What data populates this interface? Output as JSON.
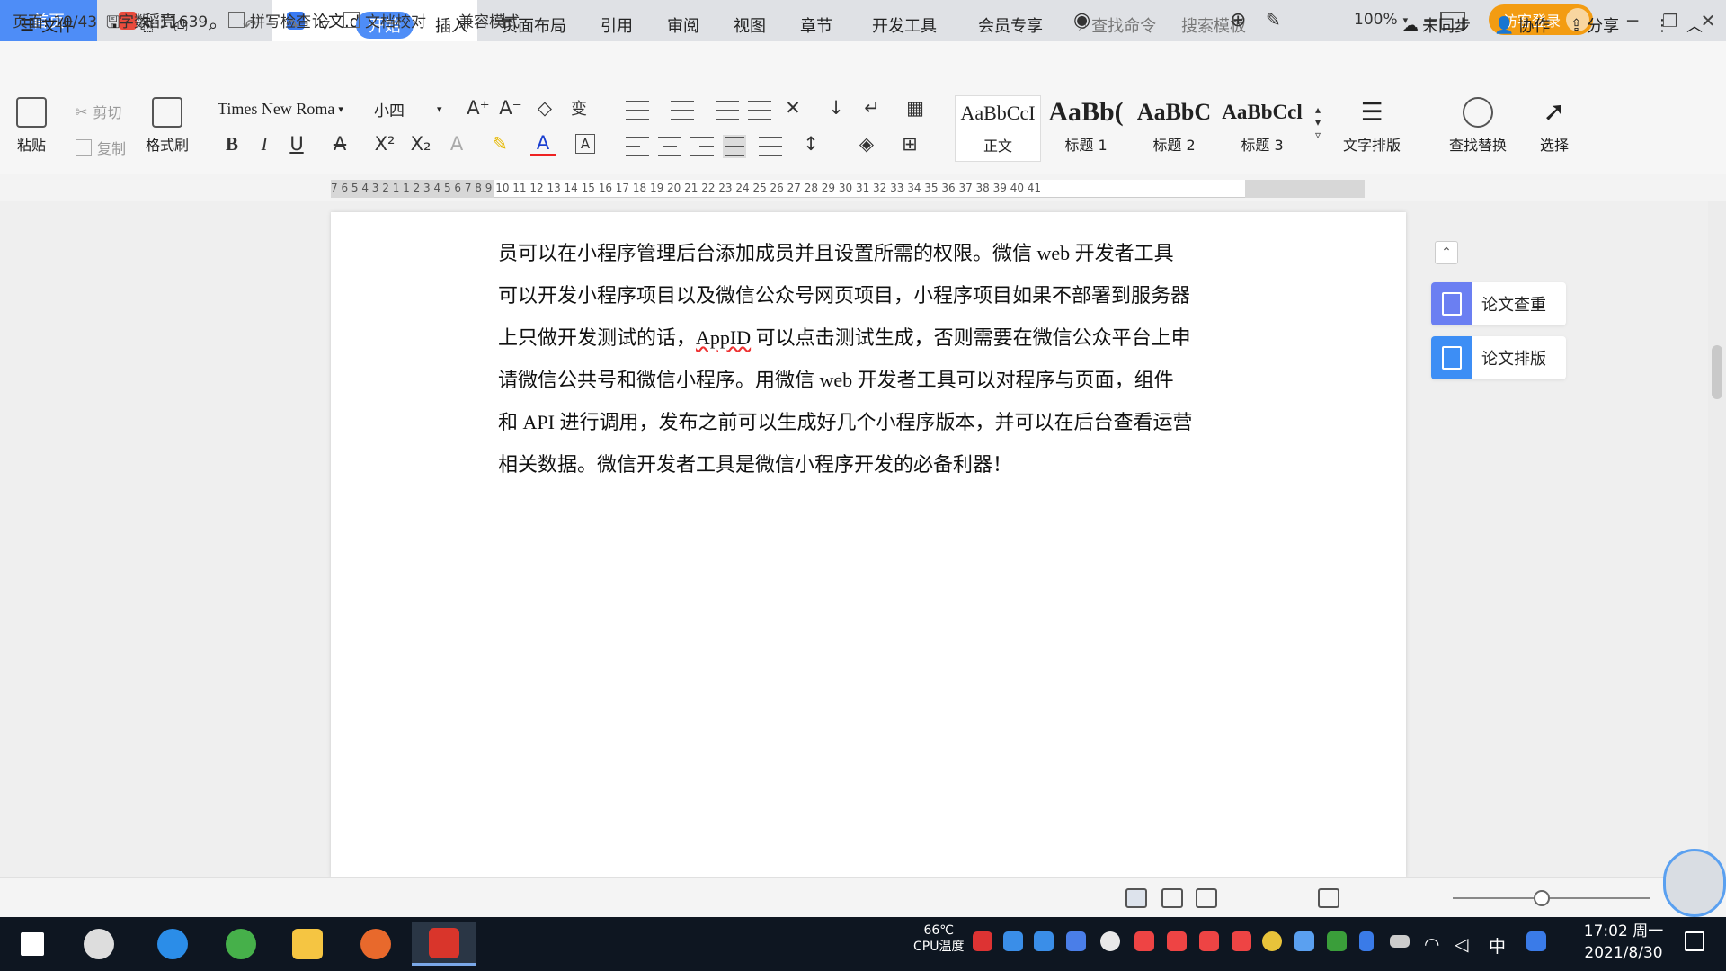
{
  "tabs": {
    "home": "首页",
    "daoke": "稻壳",
    "doc": "论文.doc",
    "add": "+"
  },
  "titlebar": {
    "visitor_login": "访客登录"
  },
  "menu": {
    "file": "文件",
    "start": "开始",
    "insert": "插入",
    "layout": "页面布局",
    "reference": "引用",
    "review": "审阅",
    "view": "视图",
    "chapter": "章节",
    "devtools": "开发工具",
    "member": "会员专享",
    "find_cmd": "查找命令",
    "search_template": "搜索模板",
    "unsync": "未同步",
    "collab": "协作",
    "share": "分享"
  },
  "ribbon": {
    "paste": "粘贴",
    "cut": "剪切",
    "copy": "复制",
    "format_painter": "格式刷",
    "font": "Times New Roma",
    "size": "小四",
    "styles": [
      {
        "preview": "AaBbCcI",
        "name": "正文"
      },
      {
        "preview": "AaBb(",
        "name": "标题 1"
      },
      {
        "preview": "AaBbC",
        "name": "标题 2"
      },
      {
        "preview": "AaBbCcl",
        "name": "标题 3"
      }
    ],
    "text_layout": "文字排版",
    "find_replace": "查找替换",
    "select": "选择"
  },
  "ruler": {
    "numbers": "7  6  5  4  3  2  1     1  2  3  4  5  6  7  8  9  10 11 12 13 14 15 16 17 18 19 20 21 22 23 24 25 26 27 28 29 30 31 32 33 34 35 36 37 38 39 40 41"
  },
  "document": {
    "lines": [
      "员可以在小程序管理后台添加成员并且设置所需的权限。微信 web 开发者工具",
      "可以开发小程序项目以及微信公众号网页项目，小程序项目如果不部署到服务器",
      "上只做开发测试的话，",
      "AppID",
      " 可以点击测试生成，否则需要在微信公众平台上申",
      "请微信公共号和微信小程序。用微信 web 开发者工具可以对程序与页面，组件",
      "和 API 进行调用，发布之前可以生成好几个小程序版本，并可以在后台查看运营",
      "相关数据。微信开发者工具是微信小程序开发的必备利器！"
    ]
  },
  "side_panel": {
    "check": "论文查重",
    "typeset": "论文排版"
  },
  "status": {
    "page": "页面: 10/43",
    "words": "字数: 11639",
    "spell": "拼写检查",
    "proof": "文档校对",
    "compat": "兼容模式",
    "zoom": "100%"
  },
  "taskbar": {
    "cpu_temp": "66℃",
    "cpu_label": "CPU温度",
    "ime": "中",
    "time": "17:02 周一",
    "date": "2021/8/30"
  },
  "colors": {
    "accent": "#4e8df7",
    "visitor": "#f39c12",
    "taskbar": "#0e1621"
  }
}
